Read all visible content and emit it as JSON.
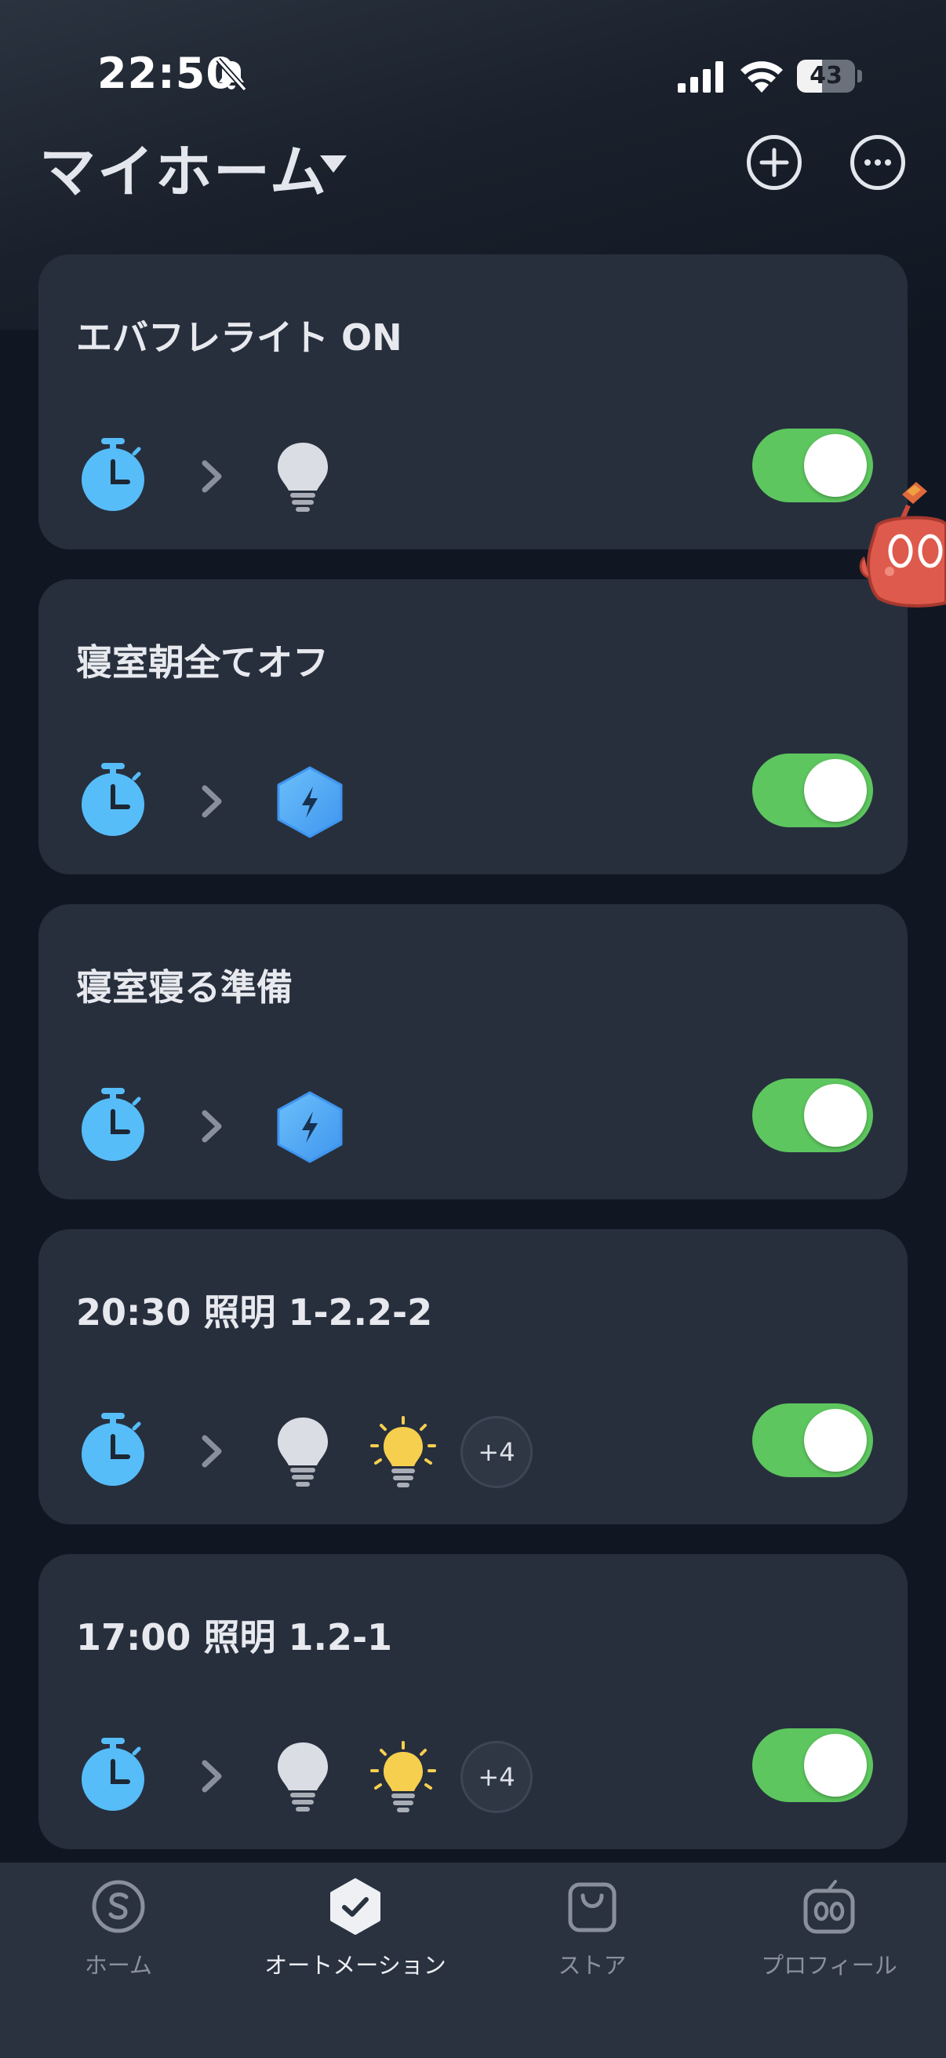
{
  "status_bar": {
    "time": "22:50",
    "battery": "43",
    "battery_level": 0.43
  },
  "header": {
    "title": "マイホーム"
  },
  "automations": [
    {
      "title": "エバフレライト ON",
      "actions": [
        "bulb-icon"
      ],
      "more": "",
      "enabled": true
    },
    {
      "title": "寝室朝全てオフ",
      "actions": [
        "scene-icon"
      ],
      "more": "",
      "enabled": true
    },
    {
      "title": "寝室寝る準備",
      "actions": [
        "scene-icon"
      ],
      "more": "",
      "enabled": true
    },
    {
      "title": "20:30 照明 1-2.2-2",
      "actions": [
        "bulb-icon",
        "bulb-on-icon"
      ],
      "more": "+4",
      "enabled": true
    },
    {
      "title": "17:00 照明 1.2-1",
      "actions": [
        "bulb-icon",
        "bulb-on-icon"
      ],
      "more": "+4",
      "enabled": true
    }
  ],
  "tabs": [
    {
      "label": "ホーム",
      "icon": "home-s-icon",
      "active": false
    },
    {
      "label": "オートメーション",
      "icon": "automation-check-icon",
      "active": true
    },
    {
      "label": "ストア",
      "icon": "store-bag-icon",
      "active": false
    },
    {
      "label": "プロフィール",
      "icon": "profile-robot-icon",
      "active": false
    }
  ],
  "colors": {
    "toggle_on": "#5dc65e",
    "timer": "#56bdf9",
    "scene": "#4aa8f5",
    "bulb_on": "#f7cf4e",
    "card": "#272f3d"
  }
}
